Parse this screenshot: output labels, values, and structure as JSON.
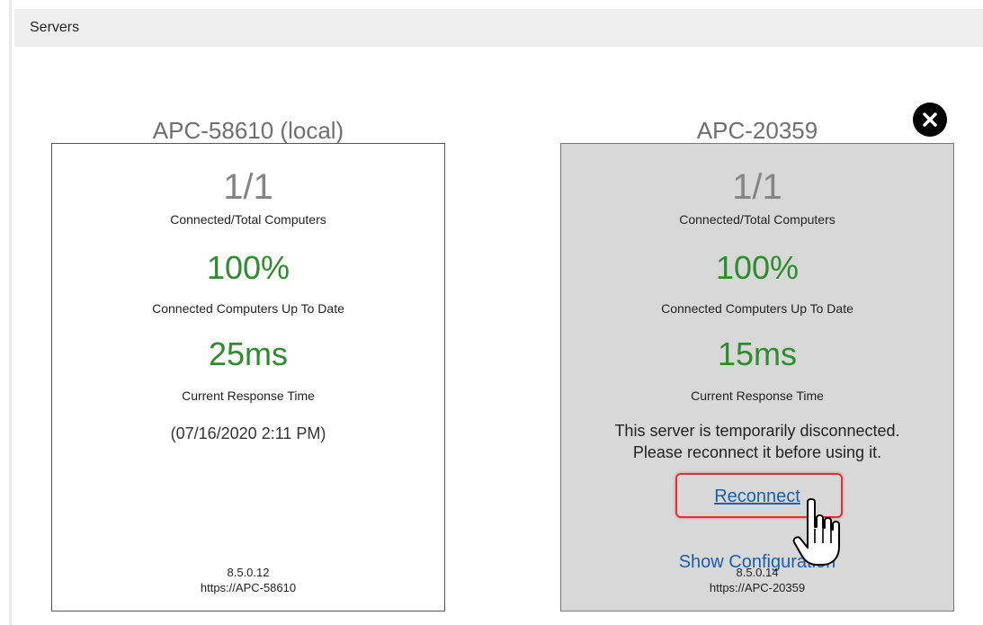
{
  "header": {
    "title": "Servers"
  },
  "servers": [
    {
      "name": "APC-58610 (local)",
      "connected_ratio": "1/1",
      "connected_label": "Connected/Total Computers",
      "uptodate_value": "100%",
      "uptodate_label": "Connected Computers Up To Date",
      "response_value": "25ms",
      "response_label": "Current Response Time",
      "timestamp": "(07/16/2020 2:11 PM)",
      "version": "8.5.0.12",
      "url": "https://APC-58610"
    },
    {
      "name": "APC-20359",
      "connected_ratio": "1/1",
      "connected_label": "Connected/Total Computers",
      "uptodate_value": "100%",
      "uptodate_label": "Connected Computers Up To Date",
      "response_value": "15ms",
      "response_label": "Current Response Time",
      "warning_line1": "This server is temporarily disconnected.",
      "warning_line2": "Please reconnect it before using it.",
      "reconnect_label": "Reconnect",
      "show_config_label": "Show Configuration",
      "version": "8.5.0.14",
      "url": "https://APC-20359",
      "status": "disconnected"
    }
  ],
  "icons": {
    "close": "close-icon",
    "cursor": "hand-pointer-icon"
  },
  "colors": {
    "header_bg": "#efefef",
    "disconnected_bg": "#d8d8d8",
    "value_green": "#2e8b2e",
    "link_blue": "#1a5fa8",
    "highlight_red": "#e0303a"
  }
}
